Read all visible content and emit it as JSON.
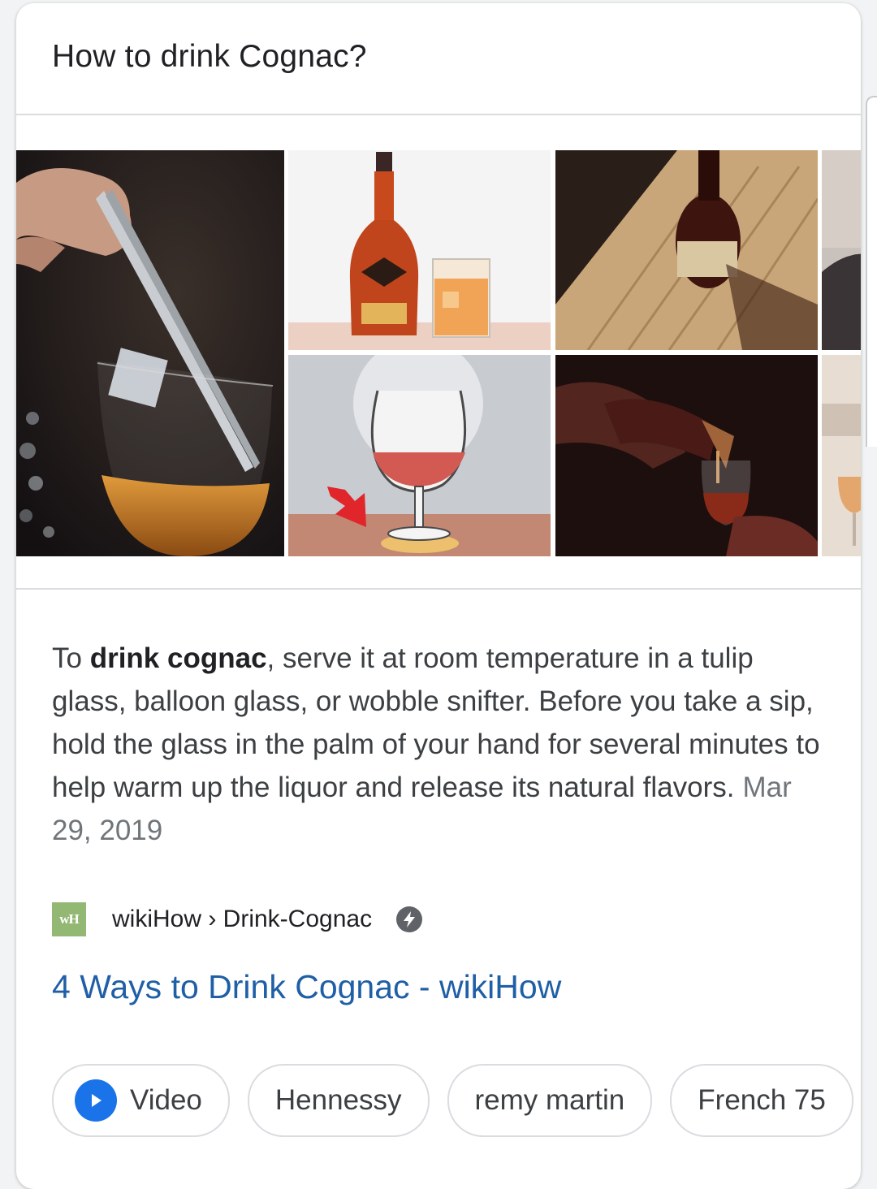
{
  "card": {
    "question": "How to drink Cognac?"
  },
  "gallery": {
    "images": [
      {
        "name": "ice-tongs-cognac-glass-photo"
      },
      {
        "name": "cognac-bottle-illustration"
      },
      {
        "name": "cognac-bottle-on-wood-photo"
      },
      {
        "name": "snifter-illustration"
      },
      {
        "name": "pouring-cognac-photo"
      },
      {
        "name": "partial-landscape-photo"
      }
    ]
  },
  "answer": {
    "prefix": "To ",
    "bold": "drink cognac",
    "text": ", serve it at room temperature in a tulip glass, balloon glass, or wobble snifter. Before you take a sip, hold the glass in the palm of your hand for several minutes to help warm up the liquor and release its natural flavors.",
    "date": "Mar 29, 2019"
  },
  "source": {
    "favicon_text": "wH",
    "breadcrumb": "wikiHow › Drink-Cognac",
    "amp_icon": "amp-lightning-icon",
    "link_title": "4 Ways to Drink Cognac - wikiHow"
  },
  "chips": {
    "items": [
      {
        "label": "Video",
        "icon": "play-icon"
      },
      {
        "label": "Hennessy"
      },
      {
        "label": "remy martin"
      },
      {
        "label": "French 75"
      }
    ]
  },
  "colors": {
    "link": "#1f5fa6",
    "accent": "#1a73e8",
    "favicon_bg": "#93b874"
  }
}
